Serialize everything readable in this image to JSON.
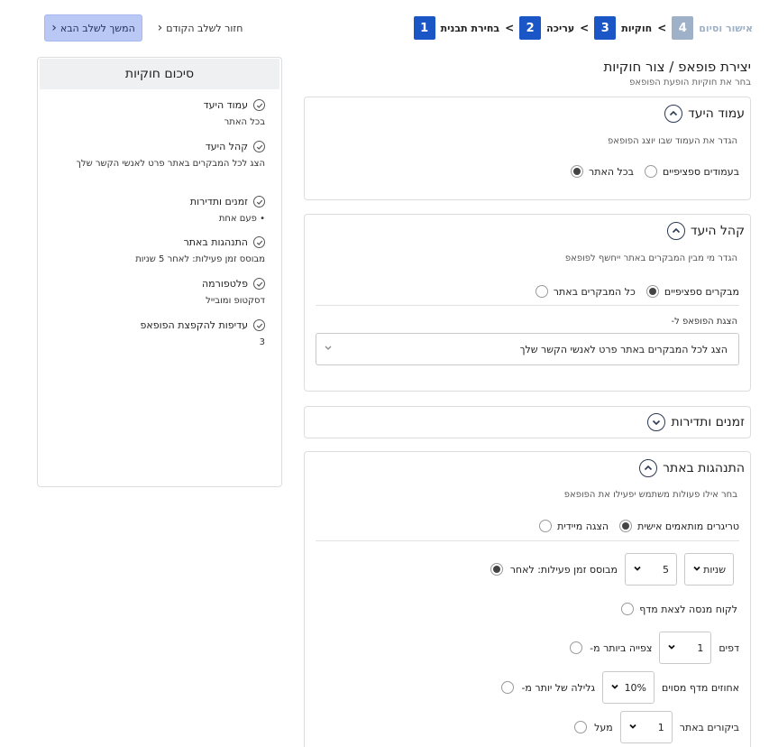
{
  "stepper": {
    "steps": [
      {
        "num": "1",
        "label": "בחירת תבנית",
        "disabled": false
      },
      {
        "num": "2",
        "label": "עריכה",
        "disabled": false
      },
      {
        "num": "3",
        "label": "חוקיות",
        "disabled": false
      },
      {
        "num": "4",
        "label": "אישור וסיום",
        "disabled": true
      }
    ],
    "separator": ">"
  },
  "nav": {
    "next_label": "המשך לשלב הבא",
    "next_icon": "‹",
    "back_label": "חזור לשלב הקודם",
    "back_icon": "‹"
  },
  "header": {
    "title": "יצירת פופאפ / צור חוקיות",
    "subtitle": "בחר את חוקיות הופעת הפופאפ"
  },
  "sections": {
    "target_page": {
      "title": "עמוד היעד",
      "desc": "הגדר את העמוד שבו יוצג הפופאפ",
      "opt_all": "בכל האתר",
      "opt_specific": "בעמודים ספציפיים"
    },
    "audience": {
      "title": "קהל היעד",
      "desc": "הגדר מי מבין המבקרים באתר ייחשף לפופאפ",
      "opt_all": "כל המבקרים באתר",
      "opt_specific": "מבקרים ספציפיים",
      "show_label": "הצגת הפופאפ ל-",
      "show_value": "הצג לכל המבקרים באתר פרט לאנשי הקשר שלך"
    },
    "timing": {
      "title": "זמנים ותדירות"
    },
    "behavior": {
      "title": "התנהגות באתר",
      "desc": "בחר אילו פעולות משתמש יפעילו את הפופאפ",
      "opt_immediate": "הצגה מיידית",
      "opt_custom": "טריגרים מותאמים אישית",
      "trigger_time_label": "מבוסס זמן פעילות: לאחר",
      "trigger_time_value": "5",
      "trigger_time_unit": "שניות",
      "trigger_exit": "לקוח מנסה לצאת מדף",
      "trigger_pages_label": "צפייה ביותר מ-",
      "trigger_pages_value": "1",
      "trigger_pages_unit": "דפים",
      "trigger_scroll_label": "גלילה של יותר מ-",
      "trigger_scroll_value": "10%",
      "trigger_scroll_unit": "אחוזים מדף מסוים",
      "trigger_visits_label": "מעל",
      "trigger_visits_value": "1",
      "trigger_visits_unit": "ביקורים באתר"
    }
  },
  "summary": {
    "title": "סיכום חוקיות",
    "items": [
      {
        "title": "עמוד היעד",
        "value": "בכל האתר"
      },
      {
        "title": "קהל היעד",
        "value": "הצג לכל המבקרים באתר פרט לאנשי הקשר שלך"
      },
      {
        "title": "זמנים ותדירות",
        "value": "• פעם אחת"
      },
      {
        "title": "התנהגות באתר",
        "value": "מבוסס זמן פעילות: לאחר 5 שניות"
      },
      {
        "title": "פלטפורמה",
        "value": "דסקטופ ומובייל"
      },
      {
        "title": "עדיפות להקפצת הפופאפ",
        "value": "3"
      }
    ]
  },
  "colors": {
    "primary": "#1a56c6",
    "disabled_step": "#9fb1c9",
    "next_button": "#b9c8f5"
  }
}
